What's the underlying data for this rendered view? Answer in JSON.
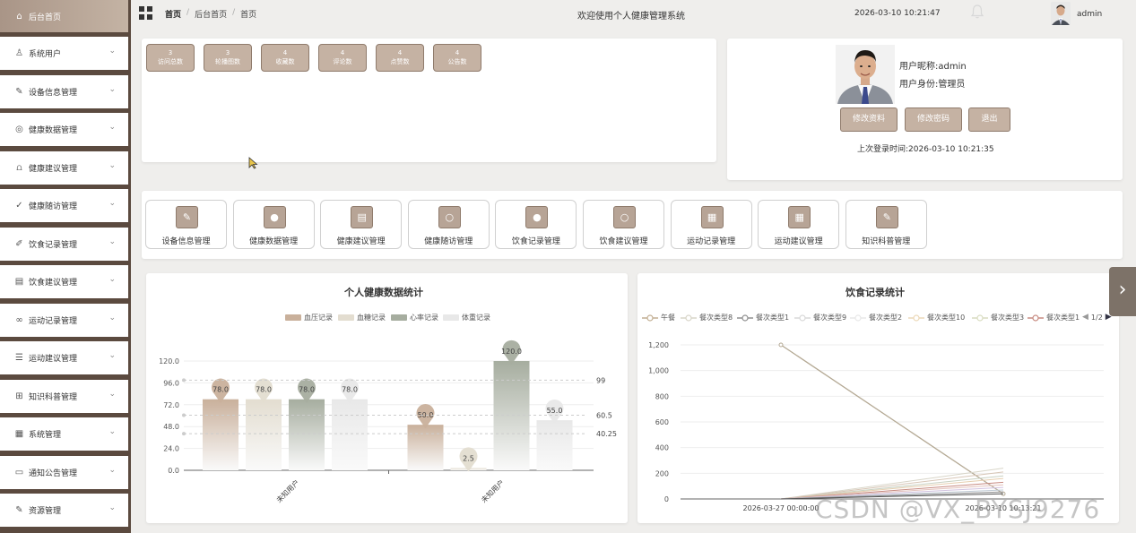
{
  "sidebar": {
    "items": [
      {
        "label": "后台首页",
        "icon": "home-icon"
      },
      {
        "label": "系统用户",
        "icon": "user-icon"
      },
      {
        "label": "设备信息管理",
        "icon": "edit-icon"
      },
      {
        "label": "健康数据管理",
        "icon": "globe-icon"
      },
      {
        "label": "健康建议管理",
        "icon": "bell-icon"
      },
      {
        "label": "健康随访管理",
        "icon": "checklist-icon"
      },
      {
        "label": "饮食记录管理",
        "icon": "pen-icon"
      },
      {
        "label": "饮食建议管理",
        "icon": "document-icon"
      },
      {
        "label": "运动记录管理",
        "icon": "link-icon"
      },
      {
        "label": "运动建议管理",
        "icon": "list-icon"
      },
      {
        "label": "知识科普管理",
        "icon": "document-plus-icon"
      },
      {
        "label": "系统管理",
        "icon": "file-icon"
      },
      {
        "label": "通知公告管理",
        "icon": "folder-icon"
      },
      {
        "label": "资源管理",
        "icon": "edit-icon"
      }
    ]
  },
  "header": {
    "breadcrumb": [
      "首页",
      "后台首页",
      "首页"
    ],
    "welcome": "欢迎使用个人健康管理系统",
    "datetime": "2026-03-10 10:21:47",
    "username": "admin"
  },
  "stats": [
    {
      "value": "3",
      "label": "访问总数"
    },
    {
      "value": "3",
      "label": "轮播图数"
    },
    {
      "value": "4",
      "label": "收藏数"
    },
    {
      "value": "4",
      "label": "评论数"
    },
    {
      "value": "4",
      "label": "点赞数"
    },
    {
      "value": "4",
      "label": "公告数"
    }
  ],
  "profile": {
    "nickname_label": "用户昵称:",
    "nickname": "admin",
    "role_label": "用户身份:",
    "role": "管理员",
    "buttons": [
      "修改资料",
      "修改密码",
      "退出"
    ],
    "last_login_label": "上次登录时间:",
    "last_login": "2026-03-10 10:21:35"
  },
  "modules": [
    {
      "label": "设备信息管理",
      "icon": "pen-icon"
    },
    {
      "label": "健康数据管理",
      "icon": "location-icon"
    },
    {
      "label": "健康建议管理",
      "icon": "document-icon"
    },
    {
      "label": "健康随访管理",
      "icon": "search-icon"
    },
    {
      "label": "饮食记录管理",
      "icon": "location-icon"
    },
    {
      "label": "饮食建议管理",
      "icon": "search-icon"
    },
    {
      "label": "运动记录管理",
      "icon": "grid-icon"
    },
    {
      "label": "运动建议管理",
      "icon": "grid-icon"
    },
    {
      "label": "知识科普管理",
      "icon": "pen-icon"
    }
  ],
  "watermark": "CSDN @VX_BYSJ9276",
  "chart_data": [
    {
      "type": "bar",
      "title": "个人健康数据统计",
      "categories": [
        "未知用户",
        "未知用户"
      ],
      "series": [
        {
          "name": "血压记录",
          "values": [
            78.0,
            50.0
          ],
          "color": "#c9b09b"
        },
        {
          "name": "血糖记录",
          "values": [
            78.0,
            2.5
          ],
          "color": "#e3ddd0"
        },
        {
          "name": "心率记录",
          "values": [
            78.0,
            120.0
          ],
          "color": "#a6ad9f"
        },
        {
          "name": "体重记录",
          "values": [
            78.0,
            55.0
          ],
          "color": "#e8e8e8"
        }
      ],
      "yticks": [
        "0.0",
        "24.0",
        "48.0",
        "72.0",
        "96.0",
        "120.0"
      ],
      "ylim": [
        0,
        120
      ],
      "reference_lines": [
        99,
        60.5,
        40.25
      ],
      "reference_labels": [
        "99",
        "60.5",
        "40.25"
      ]
    },
    {
      "type": "line",
      "title": "饮食记录统计",
      "legend": [
        "午餐",
        "餐次类型8",
        "餐次类型1",
        "餐次类型9",
        "餐次类型2",
        "餐次类型10",
        "餐次类型3",
        "餐次类型1"
      ],
      "legend_colors": [
        "#c2ae92",
        "#d8d5c8",
        "#8f8f8f",
        "#d9d9d9",
        "#e8e8e8",
        "#ecd9b8",
        "#d9dcc0",
        "#c78a80"
      ],
      "legend_page": "1/2",
      "x": [
        "2026-03-27 00:00:00",
        "2026-03-10 10:13:21"
      ],
      "yticks": [
        "0",
        "200",
        "400",
        "600",
        "800",
        "1,000",
        "1,200"
      ],
      "ylim": [
        0,
        1200
      ],
      "series": [
        {
          "values": [
            1200,
            40
          ]
        },
        {
          "values": [
            0,
            240
          ]
        },
        {
          "values": [
            0,
            210
          ]
        },
        {
          "values": [
            0,
            180
          ]
        },
        {
          "values": [
            0,
            160
          ]
        },
        {
          "values": [
            0,
            130
          ]
        },
        {
          "values": [
            0,
            110
          ]
        },
        {
          "values": [
            0,
            90
          ]
        },
        {
          "values": [
            0,
            70
          ]
        },
        {
          "values": [
            0,
            55
          ]
        },
        {
          "values": [
            0,
            40
          ]
        }
      ]
    }
  ]
}
